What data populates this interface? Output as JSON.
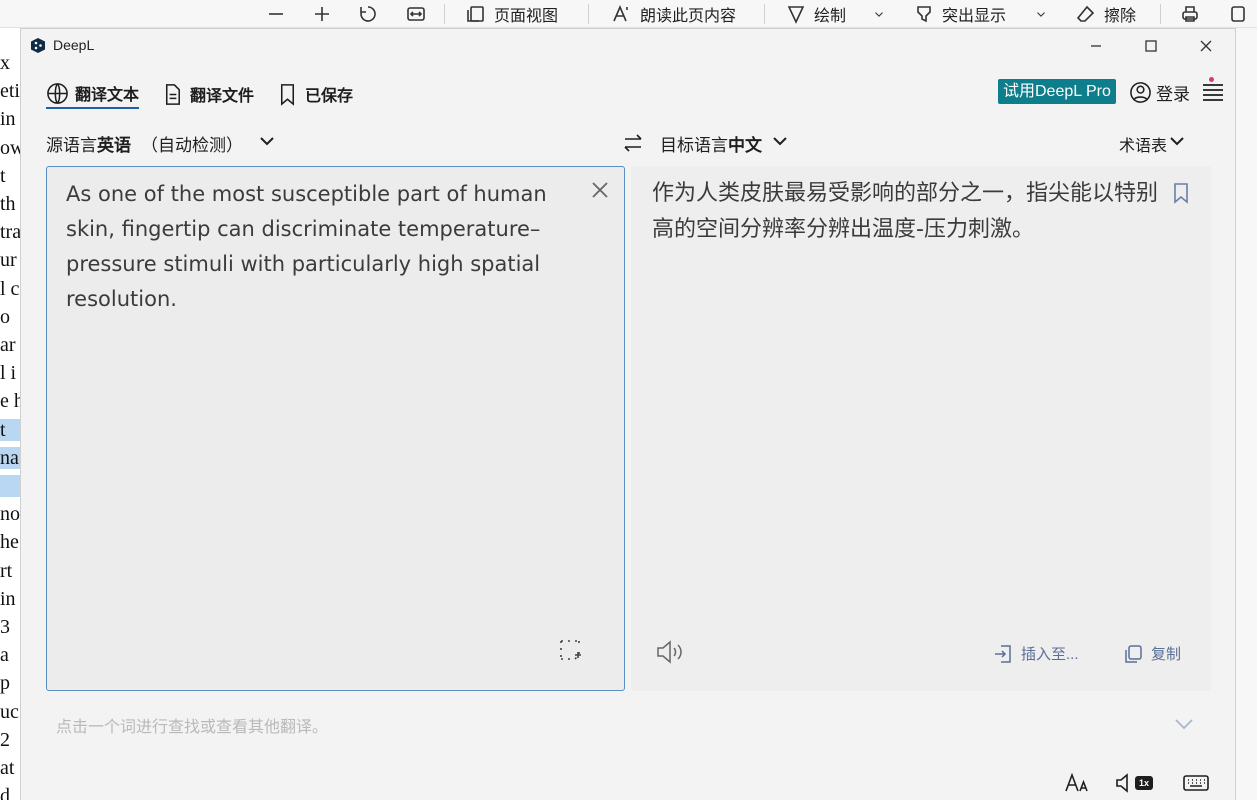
{
  "pdf_toolbar": {
    "zoom_out_icon": "minus-icon",
    "zoom_in_icon": "plus-icon",
    "rotate_icon": "rotate-icon",
    "fit_icon": "fit-width-icon",
    "page_view_label": "页面视图",
    "read_aloud_label": "朗读此页内容",
    "draw_label": "绘制",
    "highlight_label": "突出显示",
    "erase_label": "擦除"
  },
  "background_doc_lines": [
    "x",
    "eti",
    "in",
    "ow",
    "t",
    "th",
    "tra",
    "ur",
    "l c",
    "o",
    "ar",
    "l i",
    "e h",
    "t",
    "na",
    "",
    "no",
    "he",
    "rt",
    "in",
    "3",
    "a",
    "p",
    "uc",
    "2",
    "at",
    "d"
  ],
  "app": {
    "title": "DeepL",
    "tabs": [
      {
        "label": "翻译文本",
        "icon": "globe-icon"
      },
      {
        "label": "翻译文件",
        "icon": "document-icon"
      },
      {
        "label": "已保存",
        "icon": "bookmark-icon"
      }
    ],
    "pro_button": "试用DeepL Pro",
    "login_label": "登录"
  },
  "source": {
    "prefix": "源语言",
    "language": "英语",
    "detected": "（自动检测）",
    "text": "As one of the most susceptible part of human skin, fingertip can discriminate temperature–pressure stimuli with particularly high spatial resolution."
  },
  "target": {
    "prefix": "目标语言",
    "language": "中文",
    "glossary": "术语表",
    "text": "作为人类皮肤最易受影响的部分之一，指尖能以特别高的空间分辨率分辨出温度-压力刺激。",
    "insert_label": "插入至...",
    "copy_label": "复制"
  },
  "hint": "点击一个词进行查找或查看其他翻译。",
  "speed_badge": "1x",
  "colors": {
    "accent": "#1f5fa8",
    "pro": "#0f7e8c",
    "action": "#5a6e96"
  }
}
